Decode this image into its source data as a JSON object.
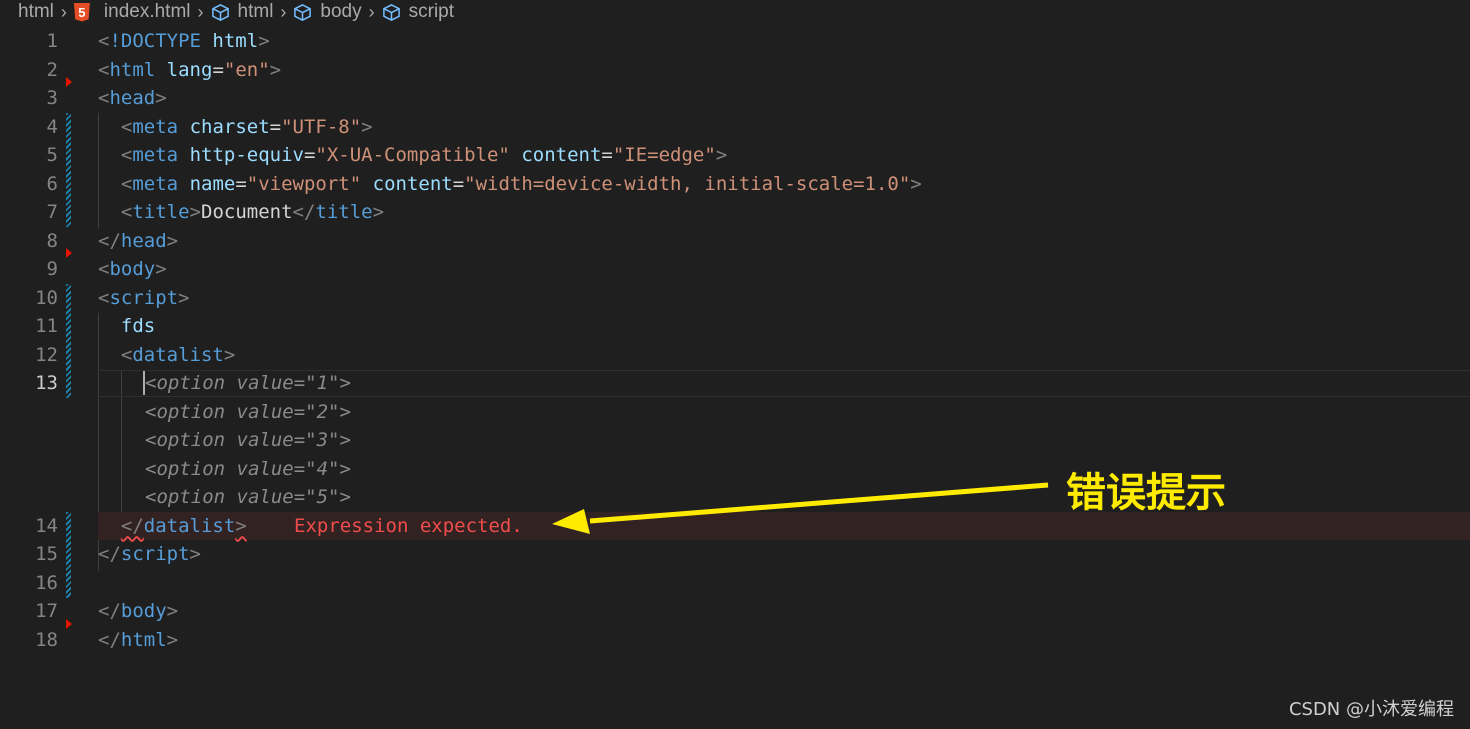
{
  "breadcrumb": [
    {
      "label": "html",
      "icon": "folder"
    },
    {
      "label": "index.html",
      "icon": "html5-icon"
    },
    {
      "label": "html",
      "icon": "cube-icon"
    },
    {
      "label": "body",
      "icon": "cube-icon"
    },
    {
      "label": "script",
      "icon": "cube-icon"
    }
  ],
  "html5_glyph": "5",
  "lines": {
    "l1": "1",
    "l2": "2",
    "l3": "3",
    "l4": "4",
    "l5": "5",
    "l6": "6",
    "l7": "7",
    "l8": "8",
    "l9": "9",
    "l10": "10",
    "l11": "11",
    "l12": "12",
    "l13": "13",
    "l14": "14",
    "l15": "15",
    "l16": "16",
    "l17": "17",
    "l18": "18"
  },
  "code": {
    "doctype": "<!DOCTYPE",
    "doctype_html": "html",
    "lang_val": "\"en\"",
    "charset_val": "\"UTF-8\"",
    "httpequiv_val": "\"X-UA-Compatible\"",
    "content_val1": "\"IE=edge\"",
    "name_val": "\"viewport\"",
    "content_val2": "\"width=device-width, initial-scale=1.0\"",
    "title_text": "Document",
    "fds": "fds",
    "ghost_options": [
      "<option value=\"1\">",
      "<option value=\"2\">",
      "<option value=\"3\">",
      "<option value=\"4\">",
      "<option value=\"5\">"
    ]
  },
  "error_message": "Expression expected.",
  "annotation": "错误提示",
  "watermark": "CSDN @小沐爱编程",
  "colors": {
    "background": "#1f1f1f",
    "tag": "#569cd6",
    "attribute": "#9cdcfe",
    "string": "#ce9178",
    "error": "#f14c4c",
    "annotation": "#ffeb00"
  }
}
